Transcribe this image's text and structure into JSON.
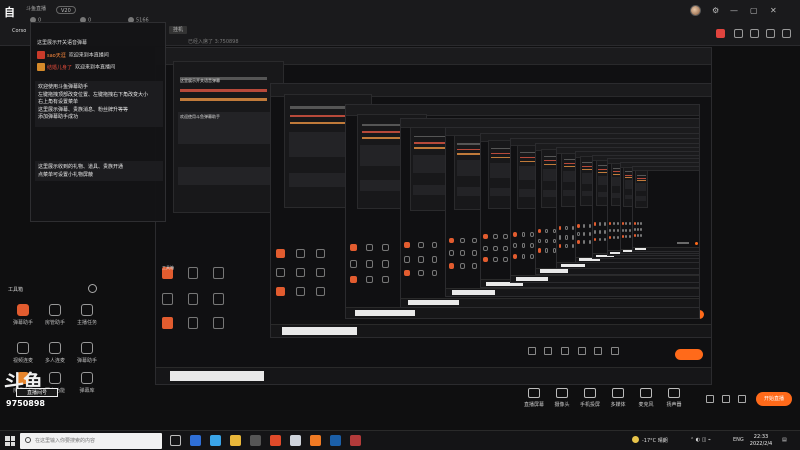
{
  "header": {
    "logo": "自",
    "room_name": "斗鱼直播",
    "room_badge": "V20",
    "stats": [
      "0",
      "0",
      "5166"
    ],
    "tabs": [
      "Corso",
      "",
      ""
    ],
    "status_tab": "挂机",
    "status_text": "已经入席了 3:750898"
  },
  "chat": {
    "title": "这里展示开关语音弹幕",
    "lines": [
      {
        "name": "sao天涯",
        "text": "欢迎来到本直播间",
        "style": "a"
      },
      {
        "name": "结婚儿身了",
        "text": "欢迎来到本直播间",
        "style": "b"
      }
    ],
    "block1": [
      "欢迎使用斗鱼弹幕助手",
      "左键拖拽顶部改变位置、左键拖拽右下角改变大小",
      "右上角有设置菜单",
      "这里展示弹幕、贵族消息、粉丝牌升等等",
      "添加弹幕助手成功"
    ],
    "block2": [
      "这里展示收到的礼物、道具、贵族开通",
      "点菜单可设置小礼物屏蔽"
    ]
  },
  "tools": {
    "title": "工具箱",
    "items": [
      {
        "label": "弹幕助手",
        "style": "or"
      },
      {
        "label": "房管助手",
        "style": ""
      },
      {
        "label": "主播任务",
        "style": ""
      },
      {
        "label": "视频连麦",
        "style": ""
      },
      {
        "label": "多人连麦",
        "style": ""
      },
      {
        "label": "弹幕助手",
        "style": ""
      },
      {
        "label": "房间设置",
        "style": "or2"
      },
      {
        "label": "更多功能",
        "style": ""
      },
      {
        "label": "弹幕库",
        "style": ""
      }
    ]
  },
  "brand": {
    "mark": "斗鱼",
    "sub": "直播间号",
    "room_number": "9750898"
  },
  "toolbar": {
    "items": [
      "直播屏幕",
      "摄像头",
      "手机投屏",
      "多媒体",
      "麦克风",
      "扬声器"
    ],
    "live_button": "开始直播"
  },
  "taskbar": {
    "search_placeholder": "在这里输入你要搜索的内容",
    "weather": "-17°C 晴朗",
    "tray_lang": "ENG",
    "time": "22:33",
    "date": "2022/2/4"
  },
  "recursive": {
    "chat_title": "这里展示开关语音弹幕",
    "hint": "欢迎使用斗鱼弹幕助手",
    "tools_title": "工具箱"
  },
  "colors": {
    "accent": "#ff6a1a",
    "tool_orange": "#e25c2f",
    "taskbar": "#141416"
  }
}
